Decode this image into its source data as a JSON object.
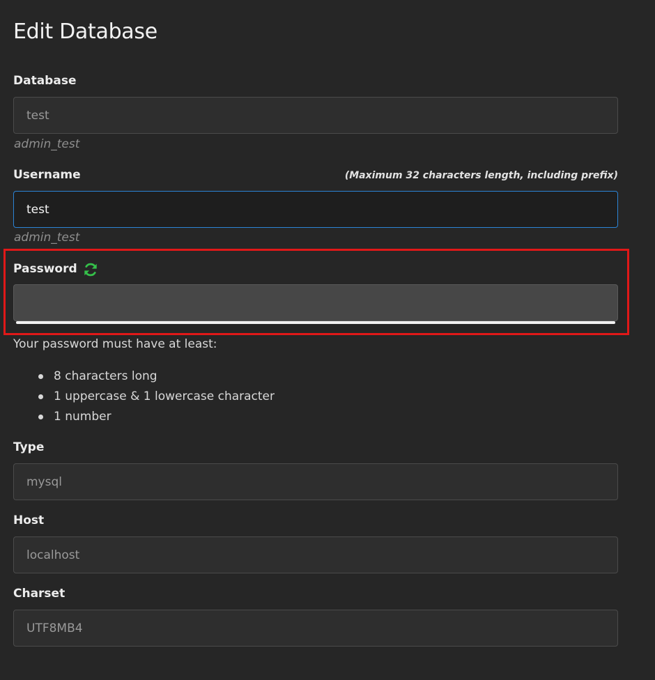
{
  "page": {
    "title": "Edit Database"
  },
  "database": {
    "label": "Database",
    "value": "test",
    "prefixed": "admin_test"
  },
  "username": {
    "label": "Username",
    "hint": "(Maximum 32 characters length, including prefix)",
    "value": "test",
    "prefixed": "admin_test"
  },
  "password": {
    "label": "Password",
    "value": "",
    "generate_icon": "refresh-icon",
    "icon_color": "#35c04a"
  },
  "requirements": {
    "intro": "Your password must have at least:",
    "items": [
      "8 characters long",
      "1 uppercase & 1 lowercase character",
      "1 number"
    ]
  },
  "type": {
    "label": "Type",
    "value": "mysql"
  },
  "host": {
    "label": "Host",
    "value": "localhost"
  },
  "charset": {
    "label": "Charset",
    "value": "UTF8MB4"
  },
  "colors": {
    "highlight": "#e01818",
    "focus_border": "#2c84d6",
    "background": "#262626"
  }
}
